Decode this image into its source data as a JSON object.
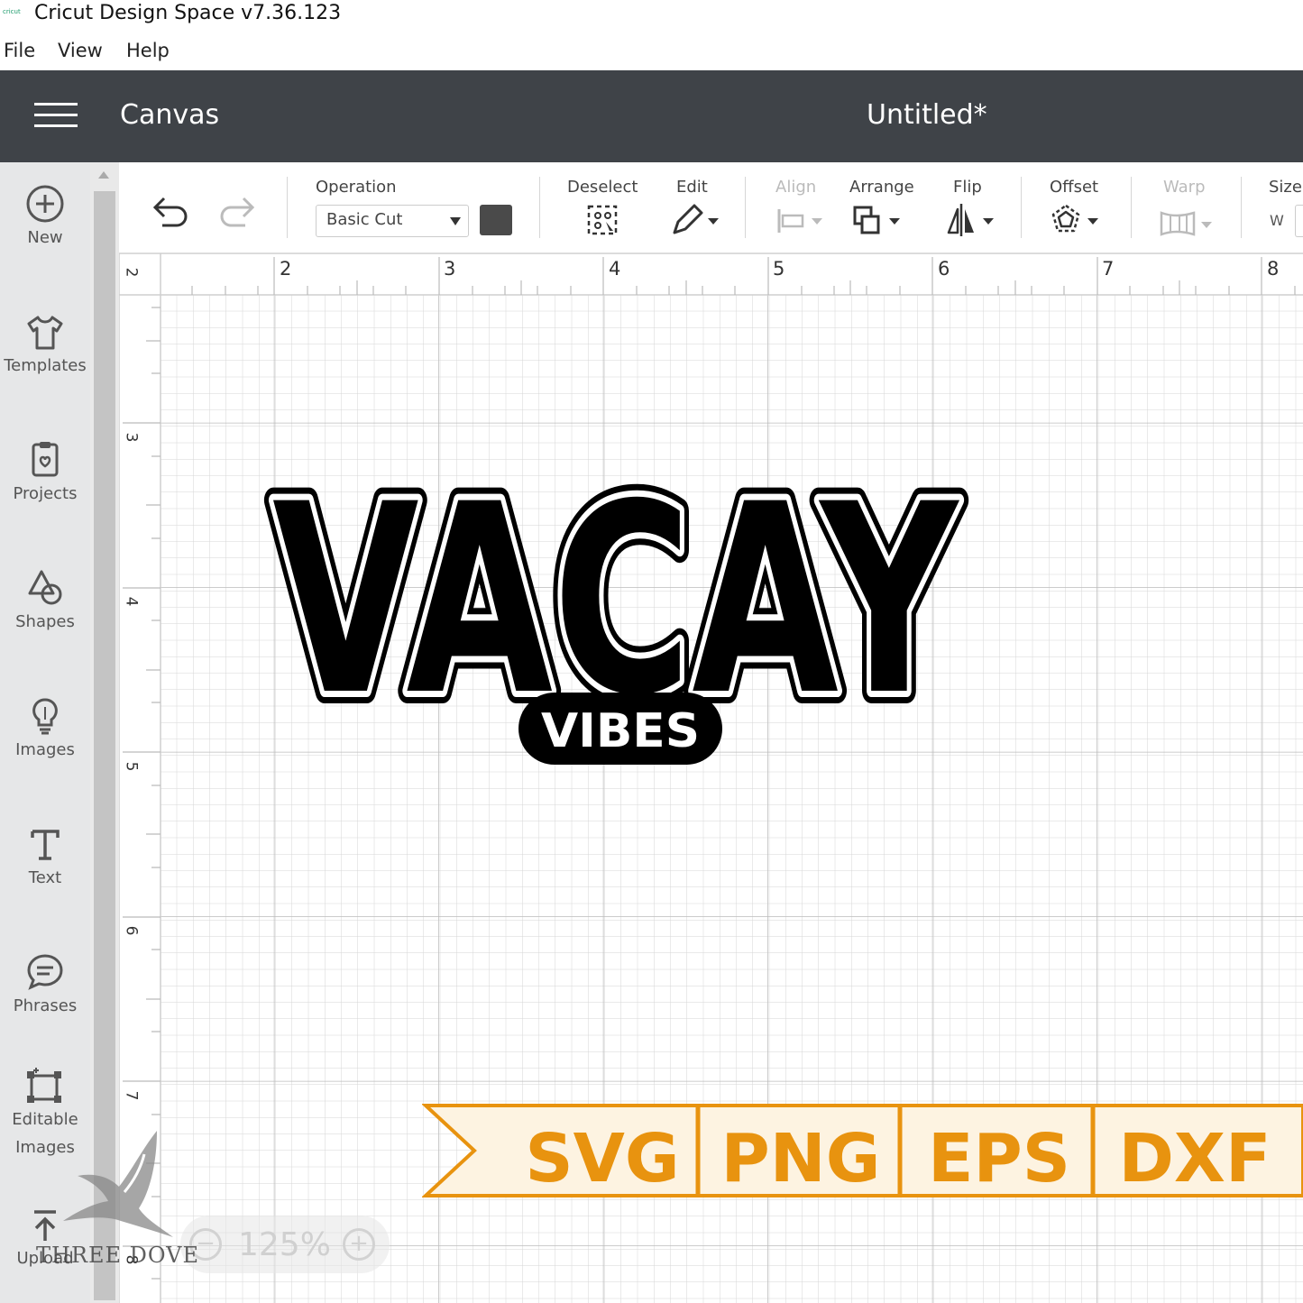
{
  "window": {
    "title": "Cricut Design Space  v7.36.123",
    "icon_text": "cricut"
  },
  "menu": [
    "File",
    "View",
    "Help"
  ],
  "header": {
    "section": "Canvas",
    "document": "Untitled*"
  },
  "sidebar": [
    {
      "label": "New",
      "icon": "plus-circle-icon"
    },
    {
      "label": "Templates",
      "icon": "tshirt-icon"
    },
    {
      "label": "Projects",
      "icon": "projects-icon"
    },
    {
      "label": "Shapes",
      "icon": "shapes-icon"
    },
    {
      "label": "Images",
      "icon": "lightbulb-icon"
    },
    {
      "label": "Text",
      "icon": "text-icon"
    },
    {
      "label": "Phrases",
      "icon": "speech-bubble-icon"
    },
    {
      "label": "Editable Images",
      "line1": "Editable",
      "line2": "Images",
      "icon": "editable-image-icon"
    },
    {
      "label": "Upload",
      "icon": "upload-icon"
    }
  ],
  "toolbar": {
    "operation_label": "Operation",
    "operation_value": "Basic Cut",
    "deselect": "Deselect",
    "edit": "Edit",
    "align": "Align",
    "arrange": "Arrange",
    "flip": "Flip",
    "offset": "Offset",
    "warp": "Warp",
    "size": "Size",
    "size_w": "W",
    "operation_color": "#4a4a4a"
  },
  "ruler": {
    "horizontal": [
      "2",
      "2",
      "3",
      "4",
      "5",
      "6",
      "7",
      "8"
    ],
    "vertical": [
      "3",
      "4",
      "5",
      "6",
      "7",
      "8"
    ]
  },
  "design": {
    "main_text": "VACAY",
    "sub_text": "VIBES"
  },
  "banner": {
    "formats": [
      "SVG",
      "PNG",
      "EPS",
      "DXF"
    ],
    "accent": "#e8930f",
    "background": "#fdf3e1"
  },
  "zoom": {
    "level": "125%"
  },
  "watermark": {
    "text": "THREE DOVE"
  }
}
